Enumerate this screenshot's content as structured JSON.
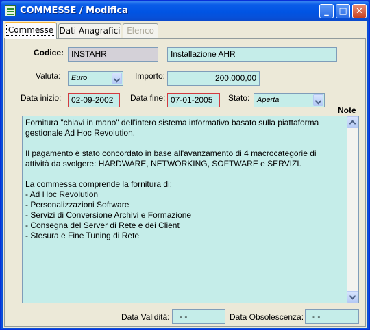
{
  "window": {
    "title": "COMMESSE / Modifica"
  },
  "tabs": [
    {
      "label": "Commesse",
      "state": "active"
    },
    {
      "label": "Dati Anagrafici",
      "state": "normal"
    },
    {
      "label": "Elenco",
      "state": "disabled"
    }
  ],
  "form": {
    "codice_label": "Codice:",
    "codice_value": "INSTAHR",
    "descrizione_value": "Installazione AHR",
    "valuta_label": "Valuta:",
    "valuta_value": "Euro",
    "importo_label": "Importo:",
    "importo_value": "200.000,00",
    "data_inizio_label": "Data inizio:",
    "data_inizio_value": "02-09-2002",
    "data_fine_label": "Data fine:",
    "data_fine_value": "07-01-2005",
    "stato_label": "Stato:",
    "stato_value": "Aperta",
    "note_label": "Note",
    "note_lines": [
      "Fornitura \"chiavi in mano\" dell'intero sistema informativo basato sulla piattaforma",
      "gestionale Ad Hoc Revolution.",
      "",
      "Il pagamento è stato concordato in base all'avanzamento di 4 macrocategorie di",
      "attività da svolgere: HARDWARE, NETWORKING, SOFTWARE e SERVIZI.",
      "",
      "La commessa comprende la fornitura di:",
      "- Ad Hoc Revolution",
      "- Personalizzazioni Software",
      "- Servizi di Conversione Archivi e Formazione",
      "- Consegna del Server di Rete e dei Client",
      "- Stesura e Fine Tuning di Rete"
    ],
    "data_validita_label": "Data Validità:",
    "data_validita_value": "- -",
    "data_obsolescenza_label": "Data Obsolescenza:",
    "data_obsolescenza_value": "- -"
  },
  "colors": {
    "field_bg": "#c5ede9",
    "titlebar": "#0054e3",
    "date_border": "#d33a40"
  }
}
